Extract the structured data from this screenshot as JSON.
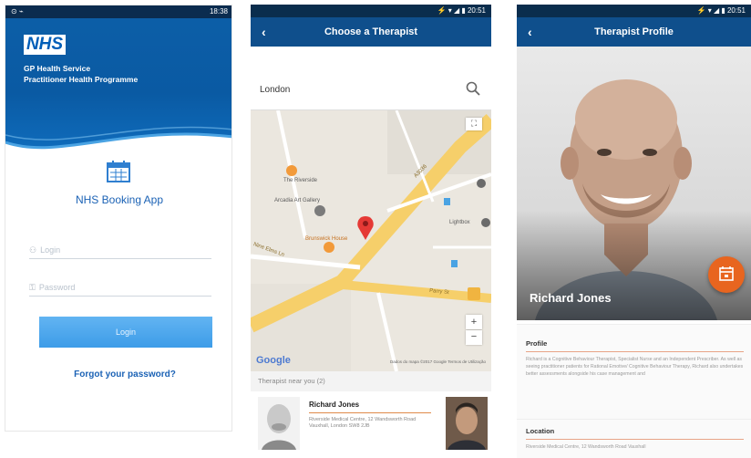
{
  "colors": {
    "nhs_blue": "#005eb8",
    "appbar": "#0f4f8c",
    "accent_orange": "#e8651f",
    "login_button": "#4aa8ee"
  },
  "screen1": {
    "status_time": "18:38",
    "logo_text": "NHS",
    "org_line1": "GP Health Service",
    "org_line2": "Practitioner Health Programme",
    "app_title": "NHS Booking App",
    "login_placeholder": "Login",
    "password_placeholder": "Password",
    "login_button": "Login",
    "forgot_password": "Forgot your password?"
  },
  "screen2": {
    "status_time": "20:51",
    "title": "Choose a Therapist",
    "search_value": "London",
    "map_labels": {
      "poi1": "The Riverside",
      "poi2": "Arcadia Art Gallery",
      "poi3": "Brunswick House",
      "poi4": "Lightbox",
      "road1": "A3036",
      "road2": "Parry St",
      "road3": "Nine Elms Ln"
    },
    "google_logo": "Google",
    "map_attribution": "Dados do mapa ©2017 Google   Termos de Utilização",
    "near_label": "Therapist near you (2)",
    "card": {
      "name": "Richard Jones",
      "address": "Riverside Medical Centre, 12 Wandsworth Road Vauxhall, London SW8 2JB"
    }
  },
  "screen3": {
    "status_time": "20:51",
    "title": "Therapist Profile",
    "therapist_name": "Richard Jones",
    "profile_heading": "Profile",
    "profile_text": "Richard is a Cognitive Behaviour Therapist, Specialist Nurse and an Independent Prescriber. As well as seeing practitioner patients for Rational Emotive/ Cognitive Behaviour Therapy, Richard also undertakes better assessments alongside his case management and",
    "location_heading": "Location",
    "location_text": "Riverside Medical Centre, 12 Wandsworth Road Vauxhall"
  }
}
